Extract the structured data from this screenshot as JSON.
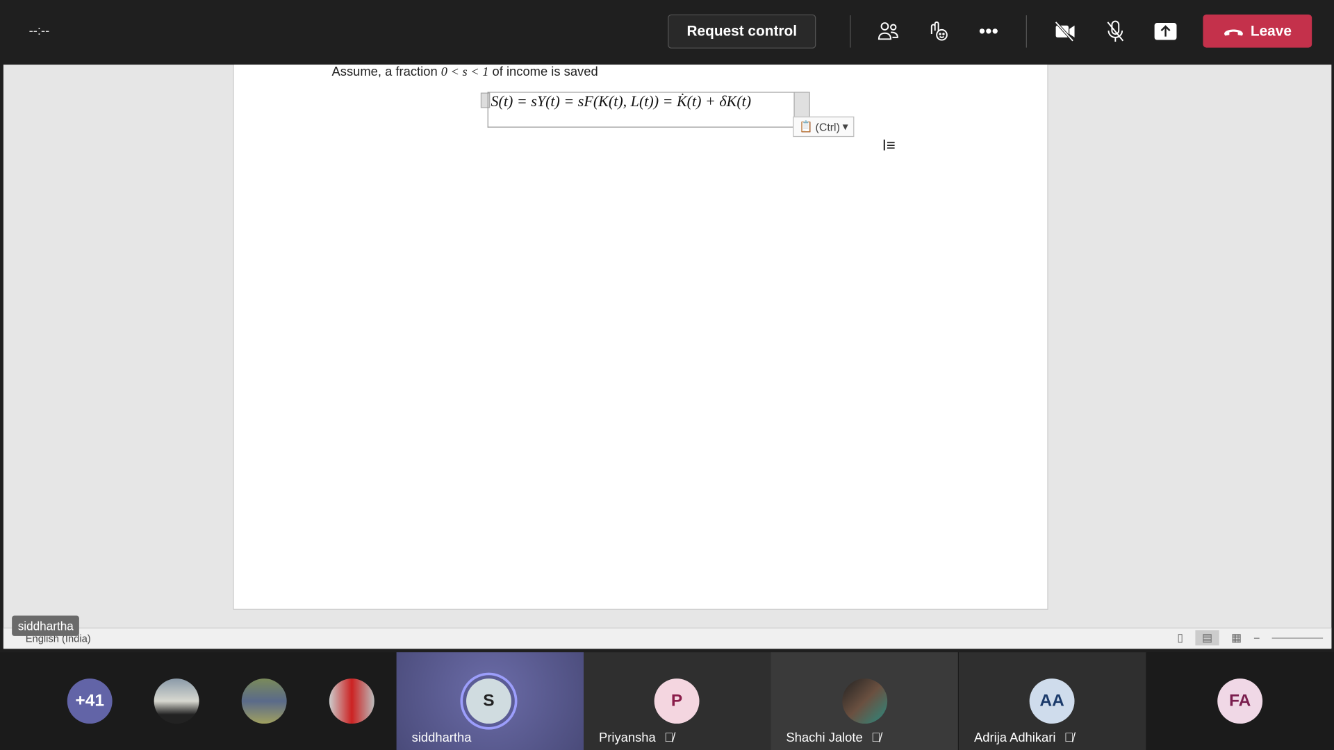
{
  "topbar": {
    "timer": "--:--",
    "request_control": "Request control",
    "leave": "Leave"
  },
  "document": {
    "line1_prefix": "Assume, a fraction ",
    "line1_math": "0 < s < 1",
    "line1_suffix": " of income is saved",
    "equation": "S(t) = sY(t) = sF(K(t), L(t)) = K̇(t) + δK(t)",
    "paste_options": "(Ctrl)",
    "language": "English (India)"
  },
  "presenter_tag": "siddhartha",
  "gallery": {
    "overflow": "+41",
    "tiles": [
      {
        "name": "siddhartha",
        "initials": "S",
        "muted": false,
        "active": true
      },
      {
        "name": "Priyansha",
        "initials": "P",
        "muted": true
      },
      {
        "name": "Shachi Jalote",
        "initials": "",
        "muted": true
      },
      {
        "name": "Adrija Adhikari",
        "initials": "AA",
        "muted": true
      },
      {
        "name": "",
        "initials": "FA"
      }
    ]
  },
  "colors": {
    "leave": "#c4314b",
    "overflow_avatar": "#6264a7",
    "active_tile": "#5b5c95"
  }
}
